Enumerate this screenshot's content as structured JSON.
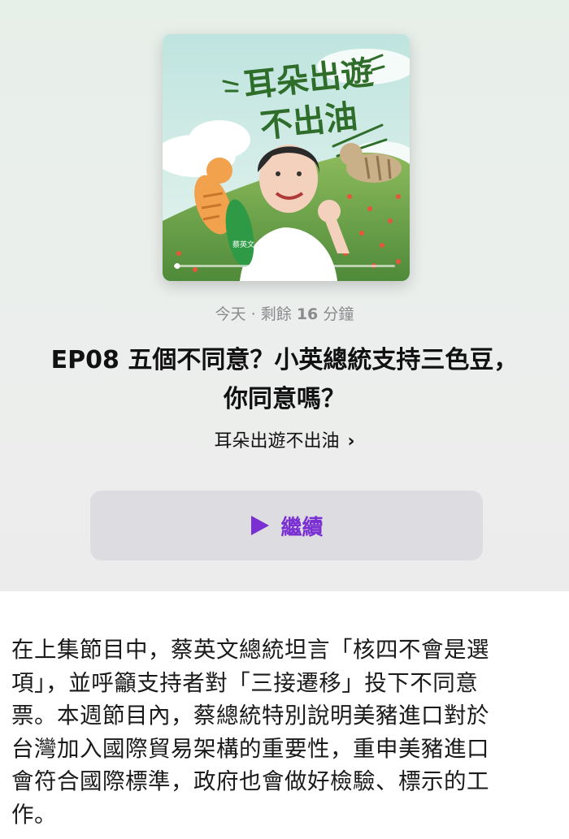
{
  "artwork": {
    "title_line1": "耳朵出遊",
    "title_line2": "不出油",
    "badge_text": "蔡英文",
    "colors": {
      "sky": "#cfe9e4",
      "grass": "#6fa24a",
      "title_green": "#2f6d2a"
    }
  },
  "episode": {
    "meta_prefix": "今天 · 剩餘",
    "meta_strong": "16",
    "meta_suffix": "分鐘",
    "title_line1": "EP08 五個不同意？小英總統支持三色豆，",
    "title_line2": "你同意嗎？",
    "show_name": "耳朵出遊不出油",
    "show_chevron": "›"
  },
  "continue_button": {
    "label": "繼續",
    "icon": "play-icon",
    "color": "#7a2fd3"
  },
  "description": {
    "lines": [
      "在上集節目中，蔡英文總統坦言「核四不會是選",
      "項」，並呼籲支持者對「三接遷移」投下不同意",
      "票。本週節目內，蔡總統特別說明美豬進口對於",
      "台灣加入國際貿易架構的重要性，重申美豬進口",
      "會符合國際標準，政府也會做好檢驗、標示的工",
      "作。"
    ]
  }
}
